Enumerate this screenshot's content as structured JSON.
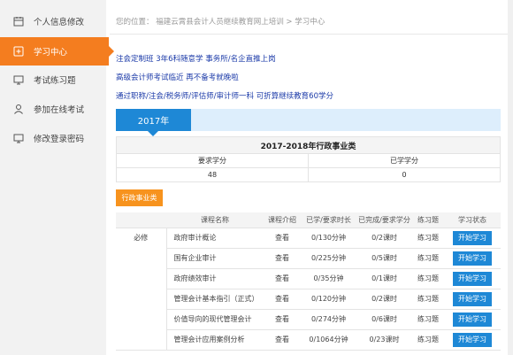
{
  "sidebar": {
    "items": [
      {
        "label": "个人信息修改",
        "icon": "calendar-icon"
      },
      {
        "label": "学习中心",
        "icon": "plus-box-icon"
      },
      {
        "label": "考试练习题",
        "icon": "monitor-icon"
      },
      {
        "label": "参加在线考试",
        "icon": "user-icon"
      },
      {
        "label": "修改登录密码",
        "icon": "monitor-icon"
      }
    ]
  },
  "breadcrumb": {
    "text": "您的位置： 福建云霄县会计人员继续教育网上培训 > 学习中心"
  },
  "promos": [
    "注会定制班 3年6科随意学 事务所/名企直推上岗",
    "高级会计师考试临近 再不备考就晚啦",
    "通过职称/注会/税务师/评估师/审计师一科 可折算继续教育60学分"
  ],
  "year_tab": "2017年",
  "summary": {
    "title": "2017-2018年行政事业类",
    "col1_header": "要求学分",
    "col2_header": "已学学分",
    "col1_value": "48",
    "col2_value": "0"
  },
  "category_button": "行政事业类",
  "courses": {
    "headers": [
      "课程名称",
      "课程介绍",
      "已学/要求时长",
      "已完成/要求学分",
      "练习题",
      "学习状态"
    ],
    "group_label": "必修",
    "rows": [
      {
        "name": "政府审计概论",
        "intro": "查看",
        "time": "0/130分钟",
        "credit": "0/2课时",
        "practice": "练习题",
        "status": "开始学习"
      },
      {
        "name": "国有企业审计",
        "intro": "查看",
        "time": "0/225分钟",
        "credit": "0/5课时",
        "practice": "练习题",
        "status": "开始学习"
      },
      {
        "name": "政府绩效审计",
        "intro": "查看",
        "time": "0/35分钟",
        "credit": "0/1课时",
        "practice": "练习题",
        "status": "开始学习"
      },
      {
        "name": "管理会计基本指引（正式）",
        "intro": "查看",
        "time": "0/120分钟",
        "credit": "0/2课时",
        "practice": "练习题",
        "status": "开始学习"
      },
      {
        "name": "价值导向的现代管理会计",
        "intro": "查看",
        "time": "0/274分钟",
        "credit": "0/6课时",
        "practice": "练习题",
        "status": "开始学习"
      },
      {
        "name": "管理会计应用案例分析",
        "intro": "查看",
        "time": "0/1064分钟",
        "credit": "0/23课时",
        "practice": "练习题",
        "status": "开始学习"
      }
    ]
  }
}
